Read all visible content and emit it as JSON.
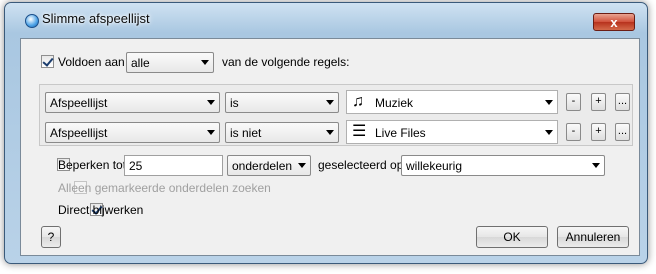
{
  "window": {
    "title": "Slimme afspeellijst",
    "close_glyph": "x"
  },
  "match": {
    "label": "Voldoen aan",
    "checked": true,
    "select_value": "alle",
    "suffix": "van de volgende regels:"
  },
  "rules": [
    {
      "field": "Afspeellijst",
      "operator": "is",
      "value": "Muziek",
      "value_icon": "music-note-icon",
      "remove_label": "-",
      "add_label": "+",
      "more_label": "..."
    },
    {
      "field": "Afspeellijst",
      "operator": "is niet",
      "value": "Live Files",
      "value_icon": "playlist-icon",
      "remove_label": "-",
      "add_label": "+",
      "more_label": "..."
    }
  ],
  "limit": {
    "label": "Beperken tot",
    "checked": false,
    "amount": "25",
    "unit": "onderdelen",
    "selected_by_label": "geselecteerd op",
    "selected_by": "willekeurig"
  },
  "checked_only": {
    "label": "Alleen gemarkeerde onderdelen zoeken",
    "checked": false,
    "enabled": false
  },
  "live_update": {
    "label": "Direct bijwerken",
    "checked": true
  },
  "buttons": {
    "help": "?",
    "ok": "OK",
    "cancel": "Annuleren"
  }
}
